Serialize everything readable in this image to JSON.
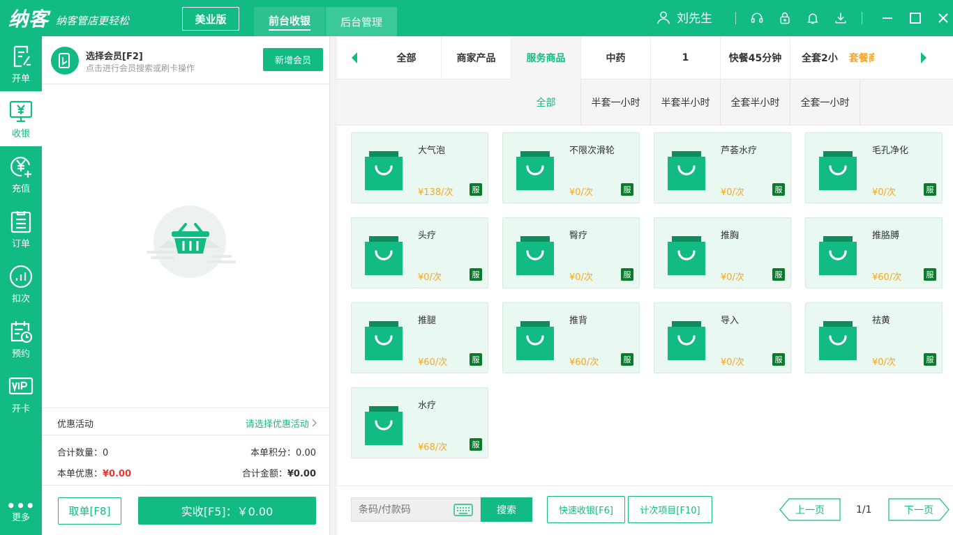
{
  "app": {
    "logo": "纳客",
    "slogan": "纳客管店更轻松",
    "edition": "美业版",
    "nav_tabs": [
      "前台收银",
      "后台管理"
    ],
    "user_name": "刘先生"
  },
  "sidebar": {
    "items": [
      {
        "label": "开单",
        "icon": "edit-doc-icon"
      },
      {
        "label": "收银",
        "icon": "cashier-icon"
      },
      {
        "label": "充值",
        "icon": "recharge-icon"
      },
      {
        "label": "订单",
        "icon": "order-list-icon"
      },
      {
        "label": "扣次",
        "icon": "deduct-icon"
      },
      {
        "label": "预约",
        "icon": "appointment-icon"
      },
      {
        "label": "开卡",
        "icon": "vip-card-icon"
      }
    ],
    "active_index": 1,
    "more_label": "更多"
  },
  "member": {
    "title": "选择会员[F2]",
    "subtitle": "点击进行会员搜索或刷卡操作",
    "new_button": "新增会员"
  },
  "promo": {
    "label": "优惠活动",
    "link": "请选择优惠活动"
  },
  "totals": {
    "qty_label": "合计数量：",
    "qty_value": "0",
    "points_label": "本单积分：",
    "points_value": "0.00",
    "discount_label": "本单优惠：",
    "discount_value": "¥0.00",
    "amount_label": "合计金额：",
    "amount_value": "¥0.00"
  },
  "actions": {
    "cancel": "取单[F8]",
    "pay": "实收[F5]：￥0.00"
  },
  "categories": {
    "tabs": [
      "全部",
      "商家产品",
      "服务商品",
      "中药",
      "1",
      "快餐45分钟"
    ],
    "active": "服务商品",
    "last_tab_text": "全套2小",
    "last_tab_overlay": "套餐商品"
  },
  "subcategories": {
    "tabs": [
      "全部",
      "半套一小时",
      "半套半小时",
      "全套半小时",
      "全套一小时"
    ],
    "active": "全部"
  },
  "products": [
    {
      "name": "大气泡",
      "price": "¥138/次",
      "badge": "服"
    },
    {
      "name": "不限次滑轮",
      "price": "¥0/次",
      "badge": "服"
    },
    {
      "name": "芦荟水疗",
      "price": "¥0/次",
      "badge": "服"
    },
    {
      "name": "毛孔净化",
      "price": "¥0/次",
      "badge": "服"
    },
    {
      "name": "头疗",
      "price": "¥0/次",
      "badge": "服"
    },
    {
      "name": "臀疗",
      "price": "¥0/次",
      "badge": "服"
    },
    {
      "name": "推胸",
      "price": "¥0/次",
      "badge": "服"
    },
    {
      "name": "推胳膊",
      "price": "¥60/次",
      "badge": "服"
    },
    {
      "name": "推腿",
      "price": "¥60/次",
      "badge": "服"
    },
    {
      "name": "推背",
      "price": "¥60/次",
      "badge": "服"
    },
    {
      "name": "导入",
      "price": "¥0/次",
      "badge": "服"
    },
    {
      "name": "祛黄",
      "price": "¥0/次",
      "badge": "服"
    },
    {
      "name": "水疗",
      "price": "¥68/次",
      "badge": "服"
    }
  ],
  "bottom": {
    "search_placeholder": "条码/付款码",
    "search_button": "搜索",
    "quick_cashier": "快速收银[F6]",
    "count_items": "计次项目[F10]",
    "prev_page": "上一页",
    "page_info": "1/1",
    "next_page": "下一页"
  },
  "colors": {
    "brand": "#12bb84",
    "price": "#f5a623",
    "badge": "#0b7a2d",
    "danger": "#e53935"
  }
}
